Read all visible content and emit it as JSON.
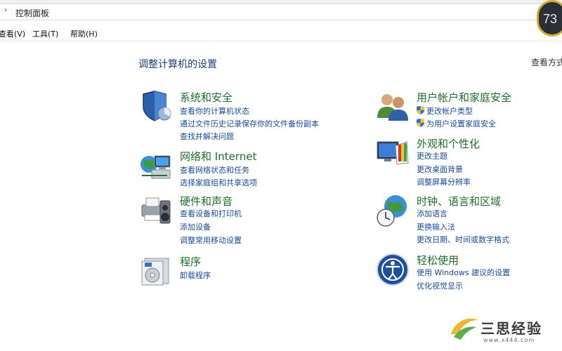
{
  "address_bar": {
    "chevron": "›",
    "path": "控制面板"
  },
  "menu": {
    "view": "查看(V)",
    "tools": "工具(T)",
    "help": "帮助(H)"
  },
  "badge": {
    "value": "73"
  },
  "page": {
    "title": "调整计算机的设置",
    "view_by": "查看方式"
  },
  "categories": [
    {
      "title": "系统和安全",
      "icon": "shield-chart-icon",
      "links": [
        "查看你的计算机状态",
        "通过文件历史记录保存你的文件备份副本",
        "查找并解决问题"
      ]
    },
    {
      "title": "网络和 Internet",
      "icon": "network-globe-icon",
      "links": [
        "查看网络状态和任务",
        "选择家庭组和共享选项"
      ]
    },
    {
      "title": "硬件和声音",
      "icon": "printer-speaker-icon",
      "links": [
        "查看设备和打印机",
        "添加设备",
        "调整常用移动设置"
      ]
    },
    {
      "title": "程序",
      "icon": "programs-box-icon",
      "links": [
        "卸载程序"
      ]
    },
    {
      "title": "用户帐户和家庭安全",
      "icon": "users-icon",
      "links": [
        "更改帐户类型",
        "为用户设置家庭安全"
      ]
    },
    {
      "title": "外观和个性化",
      "icon": "monitor-palette-icon",
      "links": [
        "更改主题",
        "更改桌面背景",
        "调整屏幕分辨率"
      ]
    },
    {
      "title": "时钟、语言和区域",
      "icon": "clock-globe-icon",
      "links": [
        "添加语言",
        "更换输入法",
        "更改日期、时间或数字格式"
      ]
    },
    {
      "title": "轻松使用",
      "icon": "ease-of-access-icon",
      "links": [
        "使用 Windows 建议的设置",
        "优化视觉显示"
      ]
    }
  ],
  "watermark": {
    "text": "三思经验",
    "url": "www.x444.com"
  }
}
